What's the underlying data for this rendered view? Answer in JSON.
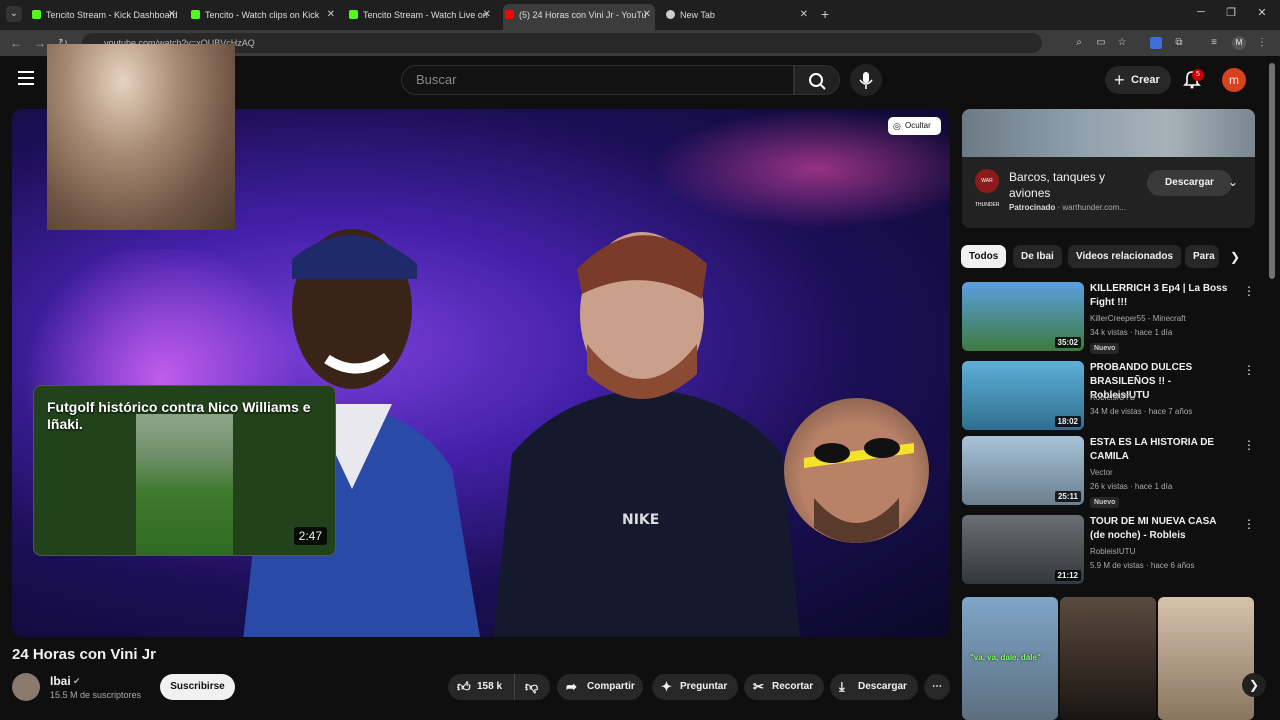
{
  "browser": {
    "tabs": [
      {
        "title": "Tencito Stream - Kick Dashboard",
        "favicon": "kick",
        "color": "#53fc18"
      },
      {
        "title": "Tencito - Watch clips on Kick",
        "favicon": "kick",
        "color": "#53fc18"
      },
      {
        "title": "Tencito Stream - Watch Live on",
        "favicon": "kick",
        "color": "#53fc18"
      },
      {
        "title": "(5) 24 Horas con Vini Jr - YouTu",
        "favicon": "youtube",
        "color": "#ff0000"
      },
      {
        "title": "New Tab",
        "favicon": "chrome",
        "color": "#cccccc"
      }
    ],
    "url": "youtube.com/watch?v=xQUBVcHzAQ",
    "profile_initial": "M"
  },
  "header": {
    "search_placeholder": "Buscar",
    "create_label": "Crear",
    "notifications_count": "5",
    "avatar_initial": "m"
  },
  "player": {
    "hide_label": "Ocultar",
    "suggestion": {
      "title": "Futgolf histórico contra Nico Williams e Iñaki.",
      "duration": "2:47"
    }
  },
  "video": {
    "title": "24 Horas con Vini Jr",
    "channel": "Ibai",
    "subscribers": "15.5 M de suscriptores",
    "subscribe_label": "Suscribirse",
    "likes": "158 k",
    "actions": {
      "share": "Compartir",
      "ask": "Preguntar",
      "clip": "Recortar",
      "download": "Descargar"
    }
  },
  "ad": {
    "title": "Barcos, tanques y aviones",
    "sponsored": "Patrocinado",
    "domain": "warthunder.com...",
    "cta": "Descargar",
    "logo_text": "WAR THUNDER"
  },
  "chips": [
    "Todos",
    "De Ibai",
    "Videos relacionados",
    "Para"
  ],
  "recommendations": [
    {
      "title": "KILLERRICH 3 Ep4 | La Boss Fight !!!",
      "channel": "KillerCreeper55 - Minecraft",
      "meta": "34 k vistas · hace 1 día",
      "duration": "35:02",
      "badge": "Nuevo",
      "thumb_color": "#4a8fd0"
    },
    {
      "title": "PROBANDO DULCES BRASILEÑOS !! - RobleisIUTU",
      "channel": "RobleisIUTU",
      "meta": "34 M de vistas · hace 7 años",
      "duration": "18:02",
      "badge": "",
      "thumb_color": "#4fa3c7"
    },
    {
      "title": "ESTA ES LA HISTORIA DE CAMILA",
      "channel": "Vector",
      "meta": "26 k vistas · hace 1 día",
      "duration": "25:11",
      "badge": "Nuevo",
      "thumb_color": "#8ab0c8"
    },
    {
      "title": "TOUR DE MI NUEVA CASA (de noche) - Robleis",
      "channel": "RobleisIUTU",
      "meta": "5.9 M de vistas · hace 6 años",
      "duration": "21:12",
      "badge": "",
      "thumb_color": "#5a5f66"
    }
  ],
  "shorts": [
    {
      "caption": "\"va, va, dale, dale\"",
      "color": "#6a8fb0"
    },
    {
      "caption": "",
      "color": "#3b3028"
    },
    {
      "caption": "",
      "color": "#b8a08a"
    }
  ]
}
